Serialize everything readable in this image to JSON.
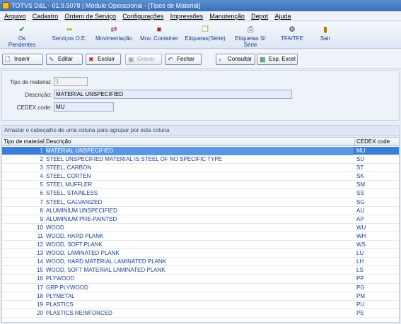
{
  "window": {
    "title": "TOTVS D&L - 01.9.5078 | Módulo Operacional - [Tipos de Material]"
  },
  "menu": [
    "Arquivo",
    "Cadastro",
    "Ordem de Serviço",
    "Configurações",
    "Impressões",
    "Manutenção",
    "Depot",
    "Ajuda"
  ],
  "toolbar": [
    {
      "label": "Os Pendentes",
      "icon": "checklist-icon"
    },
    {
      "label": "Serviços O.E.",
      "icon": "services-icon"
    },
    {
      "label": "Movimentação",
      "icon": "movement-icon"
    },
    {
      "label": "Mov. Container",
      "icon": "container-icon"
    },
    {
      "label": "Etiquetas(Série)",
      "icon": "labels-icon"
    },
    {
      "label": "Etiquetas S/ Série",
      "icon": "printer-icon"
    },
    {
      "label": "TFA/TFE",
      "icon": "tfa-icon"
    },
    {
      "label": "Sair",
      "icon": "exit-icon"
    }
  ],
  "actions": {
    "inserir": "Inserir",
    "editar": "Editar",
    "excluir": "Excluir",
    "gravar": "Gravar",
    "fechar": "Fechar",
    "consultar": "Consultar",
    "exp_excel": "Exp. Excel"
  },
  "form": {
    "tipo_label": "Tipo de material:",
    "tipo_value": "1",
    "descricao_label": "Descrição:",
    "descricao_value": "MATERIAL UNSPECIFIED",
    "cedex_label": "CEDEX code:",
    "cedex_value": "MU"
  },
  "grid": {
    "group_hint": "Arrastar o cabeçalho de uma coluna para agrupar por esta coluna",
    "columns": [
      "Tipo de material",
      "Descrição",
      "CEDEX code"
    ],
    "rows": [
      [
        "1",
        "MATERIAL UNSPECIFIED",
        "MU"
      ],
      [
        "2",
        "STEEL UNSPECIFIED MATERIAL IS STEEL OF NO SPECIFIC TYPE",
        "SU"
      ],
      [
        "3",
        "STEEL, CARBON",
        "ST"
      ],
      [
        "4",
        "STEEL, CORTEN",
        "SK"
      ],
      [
        "5",
        "STEEL MUFFLER",
        "SM"
      ],
      [
        "6",
        "STEEL, STAINLESS",
        "SS"
      ],
      [
        "7",
        "STEEL, GALVANIZED",
        "SG"
      ],
      [
        "8",
        "ALUMINIUM UNSPECIFIED",
        "AU"
      ],
      [
        "9",
        "ALUMINIUM PRE-PAINTED",
        "AP"
      ],
      [
        "10",
        "WOOD",
        "WU"
      ],
      [
        "11",
        "WOOD, HARD PLANK",
        "WH"
      ],
      [
        "12",
        "WOOD, SOFT PLANK",
        "WS"
      ],
      [
        "13",
        "WOOD, LAMINATED PLANK",
        "LU"
      ],
      [
        "14",
        "WOOD, HARD MATERIAL LAMINATED PLANK",
        "LH"
      ],
      [
        "15",
        "WOOD, SOFT MATERIAL LAMINATED PLANK",
        "LS"
      ],
      [
        "16",
        "PLYWOOD",
        "PP"
      ],
      [
        "17",
        "GRP PLYWOOD",
        "PG"
      ],
      [
        "18",
        "PLYMETAL",
        "PM"
      ],
      [
        "19",
        "PLASTICS",
        "PU"
      ],
      [
        "20",
        "PLASTICS REINFORCED",
        "PE"
      ]
    ]
  }
}
